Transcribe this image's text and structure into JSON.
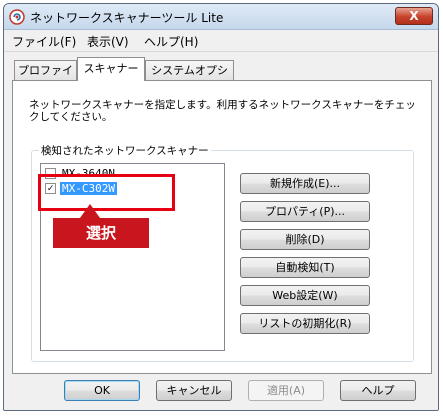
{
  "window": {
    "title": "ネットワークスキャナーツール Lite",
    "close_glyph": "X"
  },
  "menu": [
    "ファイル(F)",
    "表示(V)",
    "ヘルプ(H)"
  ],
  "tabs": [
    {
      "label": "プロファイル",
      "active": false
    },
    {
      "label": "スキャナー",
      "active": true
    },
    {
      "label": "システムオプション",
      "active": false
    }
  ],
  "panel": {
    "description": "ネットワークスキャナーを指定します。利用するネットワークスキャナーをチェックしてください。",
    "group_label": "検知されたネットワークスキャナー",
    "scanners": [
      {
        "name": "MX-3640N",
        "checked": false,
        "selected": false
      },
      {
        "name": "MX-C302W",
        "checked": true,
        "selected": true
      }
    ],
    "buttons": [
      "新規作成(E)...",
      "プロパティ(P)...",
      "削除(D)",
      "自動検知(T)",
      "Web設定(W)",
      "リストの初期化(R)"
    ]
  },
  "footer": {
    "ok": "OK",
    "cancel": "キャンセル",
    "apply": "適用(A)",
    "help": "ヘルプ"
  },
  "annotation": {
    "label": "選択",
    "color": "#e60012"
  },
  "check_glyph": "✓"
}
